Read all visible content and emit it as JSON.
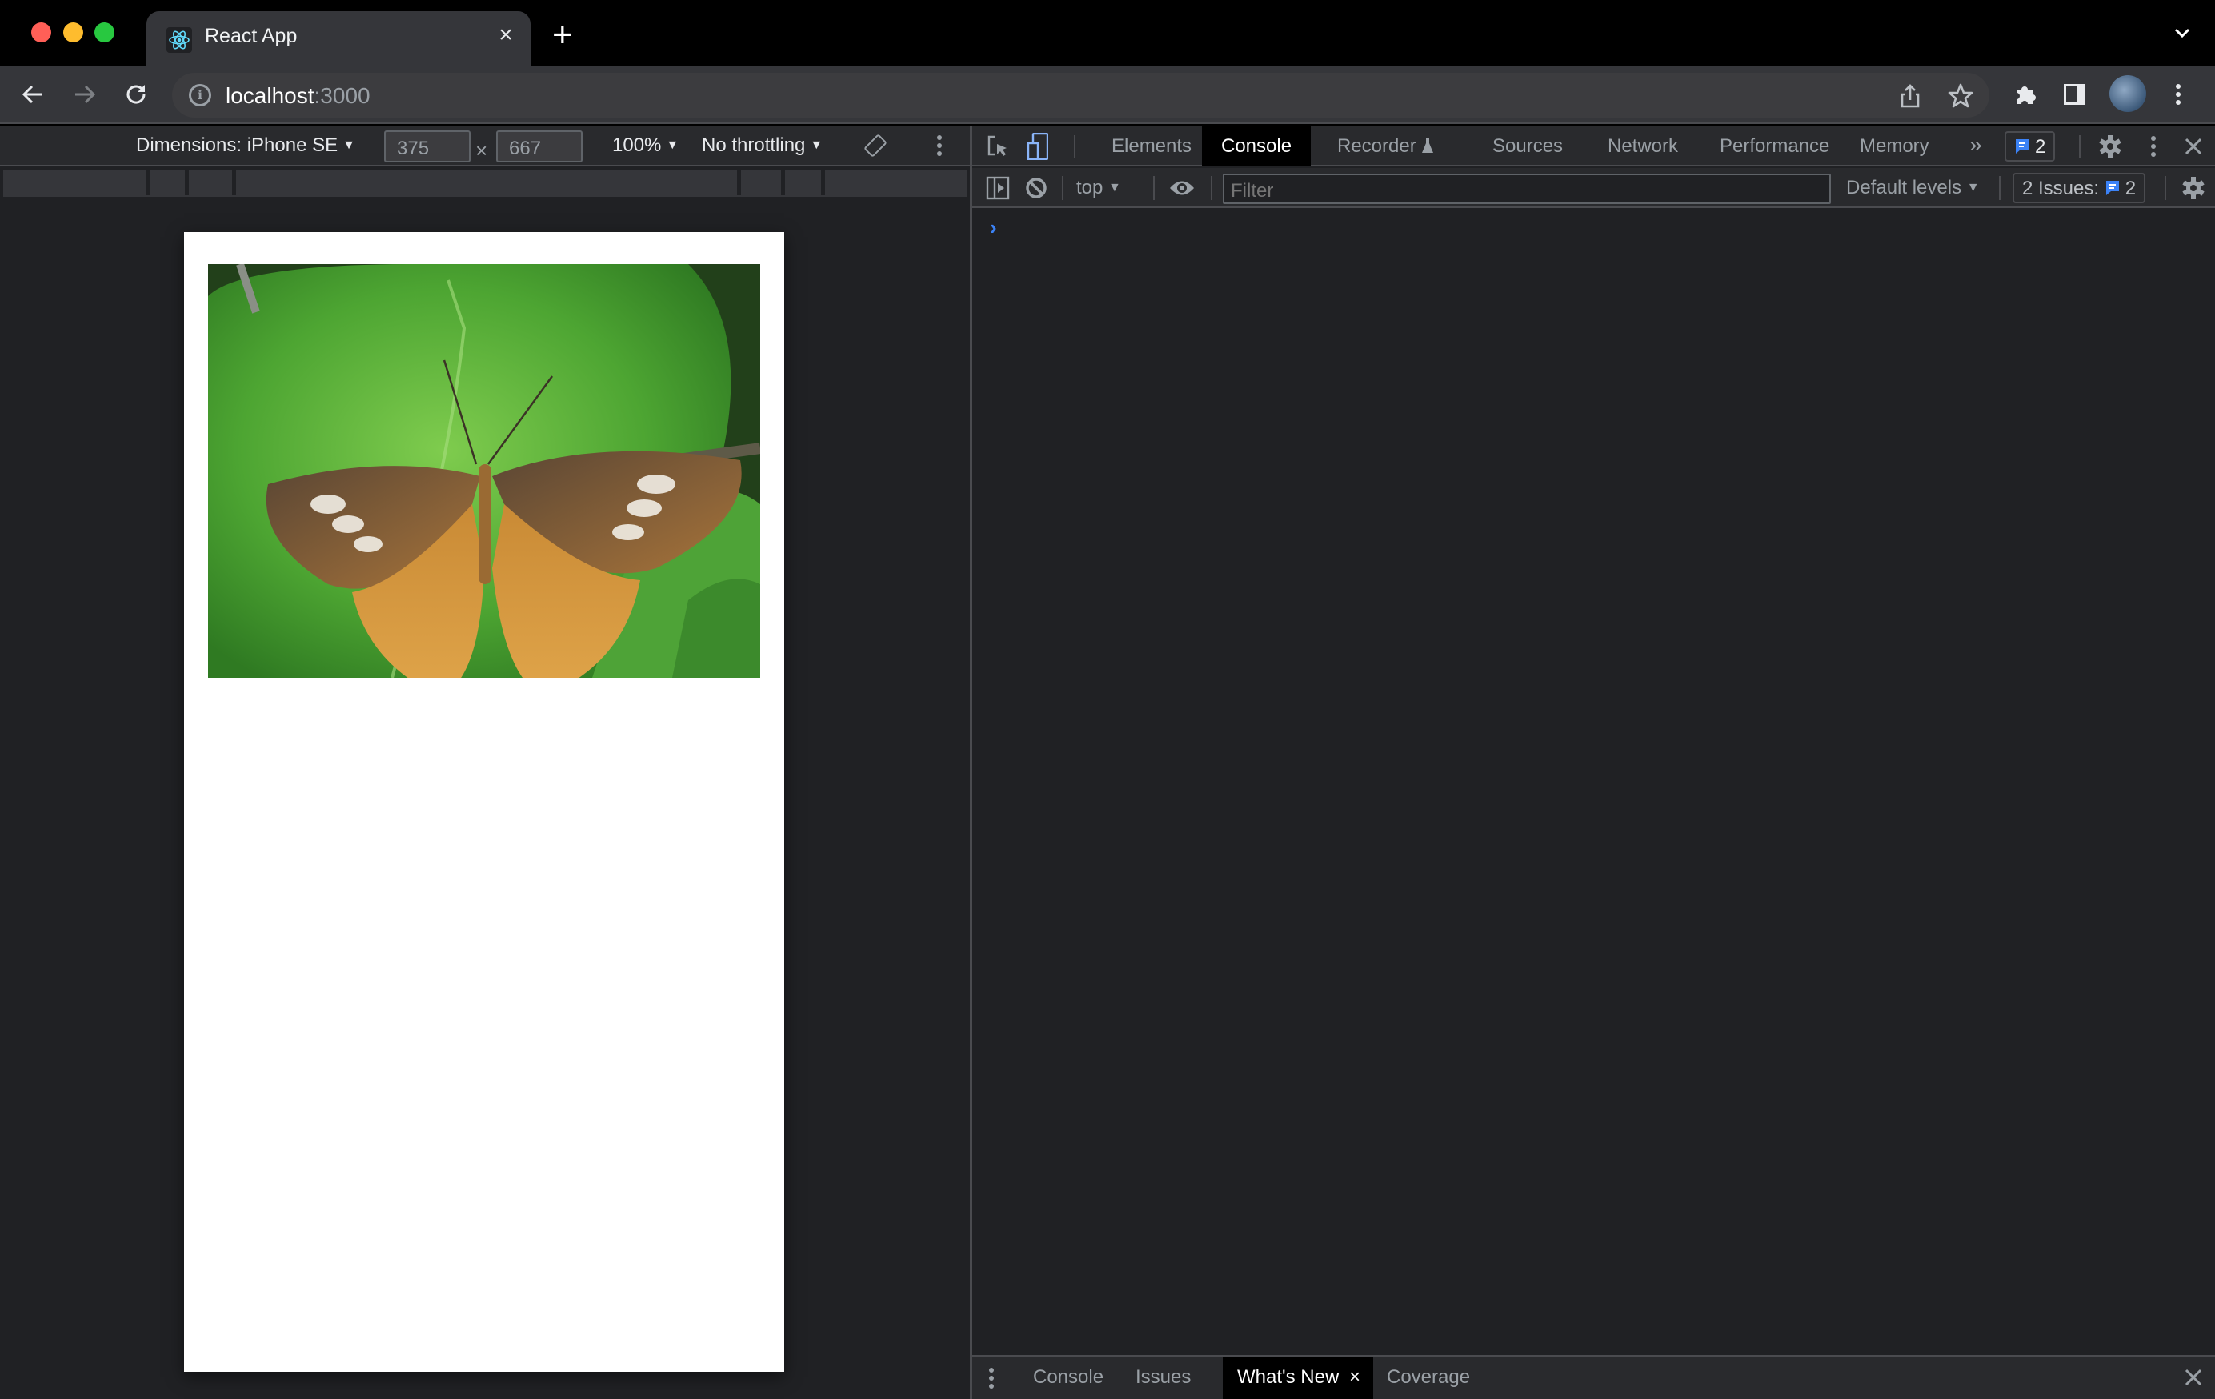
{
  "window": {
    "traffic_lights": [
      "close",
      "minimize",
      "zoom"
    ]
  },
  "tab": {
    "title": "React App",
    "favicon": "react-logo-icon",
    "close_label": "×",
    "new_tab_label": "+"
  },
  "toolbar": {
    "url_host": "localhost",
    "url_port": ":3000",
    "icons": [
      "back-icon",
      "forward-icon",
      "reload-icon",
      "site-info-icon",
      "share-icon",
      "bookmark-star-icon",
      "extensions-icon",
      "side-panel-icon",
      "profile-avatar",
      "menu-icon"
    ]
  },
  "device_toolbar": {
    "dimensions_label": "Dimensions: iPhone SE",
    "width_value": "375",
    "height_value": "667",
    "times_sign": "×",
    "zoom_label": "100%",
    "throttling_label": "No throttling",
    "caret": "▼"
  },
  "page": {
    "image_alt": "Butterfly on a green leaf"
  },
  "devtools": {
    "tabs": [
      {
        "label": "Elements",
        "active": false
      },
      {
        "label": "Console",
        "active": true
      },
      {
        "label": "Recorder",
        "active": false
      },
      {
        "label": "Sources",
        "active": false
      },
      {
        "label": "Network",
        "active": false
      },
      {
        "label": "Performance",
        "active": false
      },
      {
        "label": "Memory",
        "active": false
      }
    ],
    "more_tabs_label": "»",
    "issues_badge_count": "2",
    "console_toolbar": {
      "context": "top",
      "filter_placeholder": "Filter",
      "levels": "Default levels",
      "issues_label": "2 Issues:",
      "issues_count": "2"
    },
    "prompt_symbol": "›",
    "drawer": {
      "tabs": [
        {
          "label": "Console",
          "active": false
        },
        {
          "label": "Issues",
          "active": false
        },
        {
          "label": "What's New",
          "active": true,
          "closable": true
        },
        {
          "label": "Coverage",
          "active": false
        }
      ],
      "close_label": "×"
    }
  },
  "colors": {
    "accent_blue": "#3b82f6",
    "device_toggle_blue": "#8ab4f8",
    "active_tab_bg": "#000000"
  }
}
